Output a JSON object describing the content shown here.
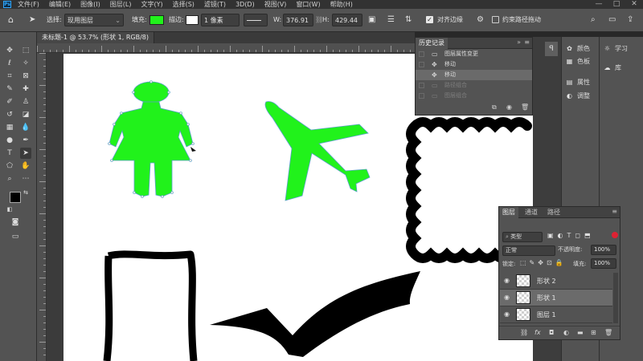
{
  "app": {
    "logo": "Ps"
  },
  "menubar": {
    "items": [
      "文件(F)",
      "编辑(E)",
      "图像(I)",
      "图层(L)",
      "文字(Y)",
      "选择(S)",
      "滤镜(T)",
      "3D(D)",
      "视图(V)",
      "窗口(W)",
      "帮助(H)"
    ],
    "window_controls": [
      "—",
      "□",
      "✕"
    ]
  },
  "options_bar": {
    "select_label": "选择:",
    "select_value": "现用图层",
    "fill_label": "填充:",
    "fill_color": "#21f21b",
    "stroke_label": "描边:",
    "stroke_width": "1 像素",
    "w_label": "W:",
    "w_value": "376.91",
    "h_label": "H:",
    "h_value": "429.44",
    "align_edges_label": "对齐边缘",
    "constrain_path_label": "约束路径拖动"
  },
  "document": {
    "tab_title": "未标题-1 @ 53.7% (形状 1, RGB/8) *",
    "close_glyph": "×"
  },
  "toolbar": {
    "tools": [
      "move-tool",
      "marquee-tool",
      "lasso-tool",
      "magic-wand-tool",
      "crop-tool",
      "frame-tool",
      "eyedropper-tool",
      "healing-tool",
      "brush-tool",
      "stamp-tool",
      "history-brush-tool",
      "eraser-tool",
      "gradient-tool",
      "blur-tool",
      "dodge-tool",
      "pen-tool",
      "type-tool",
      "path-select-tool",
      "shape-tool",
      "hand-tool",
      "zoom-tool",
      "more-tool"
    ],
    "foreground_color": "#000000",
    "background_color": "#ffffff"
  },
  "history_panel": {
    "title": "历史记录",
    "rows": [
      {
        "label": "图层属性变更",
        "state": "normal"
      },
      {
        "label": "移动",
        "state": "normal"
      },
      {
        "label": "移动",
        "state": "selected"
      },
      {
        "label": "路径组合",
        "state": "dim"
      },
      {
        "label": "图层组合",
        "state": "dim"
      }
    ]
  },
  "layers_panel": {
    "tabs": [
      "图层",
      "通道",
      "路径"
    ],
    "kind_label": "类型",
    "blend_mode": "正常",
    "opacity_label": "不透明度:",
    "opacity_value": "100%",
    "lock_label": "锁定:",
    "fill_label": "填充:",
    "fill_value": "100%",
    "layers": [
      {
        "name": "形状 2",
        "selected": false
      },
      {
        "name": "形状 1",
        "selected": true
      },
      {
        "name": "图层 1",
        "selected": false
      }
    ],
    "footer_icons": [
      "link-icon",
      "fx-icon",
      "mask-icon",
      "adjustment-icon",
      "group-icon",
      "new-layer-icon",
      "trash-icon"
    ]
  },
  "side_panels": {
    "col1": [
      {
        "label": "颜色",
        "icon": "palette-icon"
      },
      {
        "label": "色板",
        "icon": "swatches-icon"
      },
      {
        "label": "属性",
        "icon": "properties-icon"
      },
      {
        "label": "调整",
        "icon": "adjustments-icon"
      }
    ],
    "col2": [
      {
        "label": "学习",
        "icon": "bulb-icon"
      },
      {
        "label": "库",
        "icon": "cloud-icon"
      }
    ]
  },
  "shape_colors": {
    "green": "#21f21b",
    "black": "#000000"
  }
}
